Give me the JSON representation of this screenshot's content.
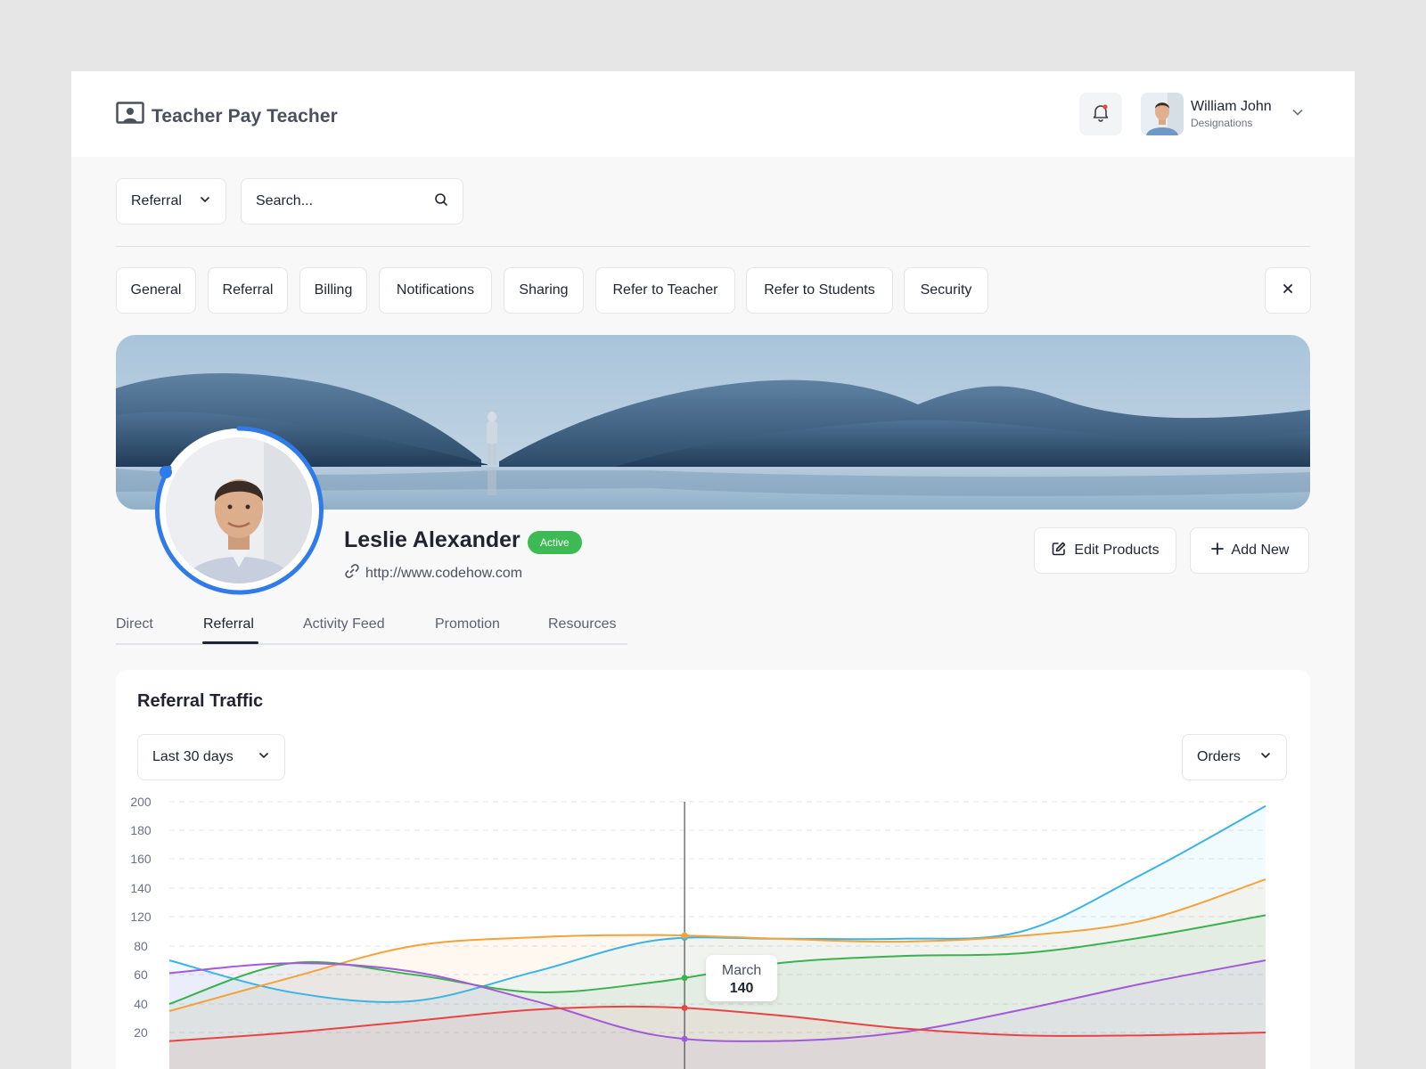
{
  "app": {
    "title": "Teacher Pay Teacher"
  },
  "header": {
    "user_name": "William John",
    "user_role": "Designations",
    "notification_dot_color": "#e5484d"
  },
  "filter": {
    "selected": "Referral",
    "search_placeholder": "Search..."
  },
  "settings_tabs": [
    "General",
    "Referral",
    "Billing",
    "Notifications",
    "Sharing",
    "Refer to Teacher",
    "Refer to Students",
    "Security"
  ],
  "profile": {
    "name": "Leslie Alexander",
    "status": "Active",
    "website": "http://www.codehow.com",
    "edit_label": "Edit Products",
    "add_label": "Add New"
  },
  "profile_tabs": {
    "items": [
      "Direct",
      "Referral",
      "Activity Feed",
      "Promotion",
      "Resources"
    ],
    "active": "Referral"
  },
  "traffic": {
    "title": "Referral Traffic",
    "range": "Last 30 days",
    "metric": "Orders",
    "tooltip_label": "March",
    "tooltip_value": "140"
  },
  "colors": {
    "accent": "#2f7be9",
    "active_badge": "#3dba54"
  },
  "chart_data": {
    "type": "area",
    "x": [
      0,
      1,
      2,
      3,
      4,
      5,
      6,
      7,
      8,
      9
    ],
    "y_ticks": [
      20,
      40,
      60,
      80,
      120,
      140,
      160,
      180,
      200
    ],
    "ylim": [
      0,
      200
    ],
    "grid": true,
    "series": [
      {
        "color": "#3bb4e5",
        "values": [
          70,
          48,
          42,
          62,
          88,
          90,
          90,
          100,
          150,
          197
        ]
      },
      {
        "color": "#f5a23a",
        "values": [
          35,
          58,
          80,
          92,
          95,
          90,
          86,
          94,
          115,
          146
        ]
      },
      {
        "color": "#3bb14f",
        "values": [
          40,
          68,
          60,
          48,
          55,
          68,
          73,
          75,
          92,
          121
        ]
      },
      {
        "color": "#a25ad8",
        "values": [
          61,
          68,
          62,
          42,
          18,
          14,
          20,
          36,
          54,
          70
        ]
      },
      {
        "color": "#e84444",
        "values": [
          14,
          20,
          28,
          36,
          38,
          32,
          23,
          18,
          18,
          20
        ]
      }
    ]
  }
}
